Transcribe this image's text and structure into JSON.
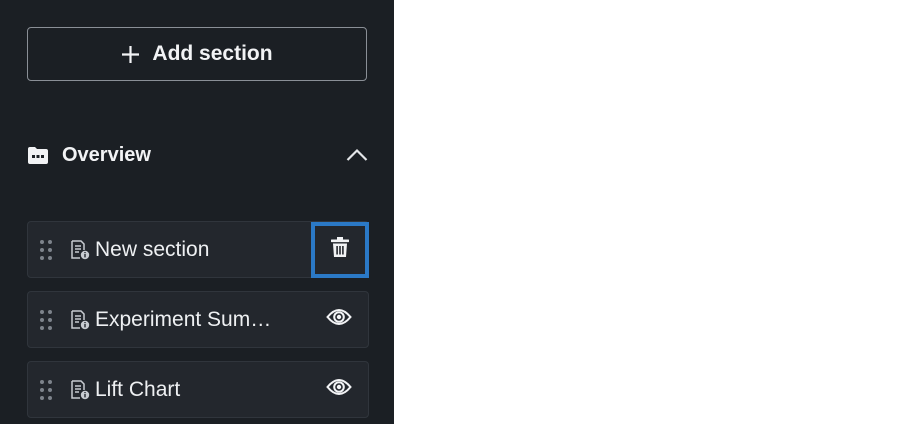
{
  "sidebar": {
    "add_section_label": "Add section",
    "group": {
      "title": "Overview",
      "expanded": true
    },
    "items": [
      {
        "label": "New section",
        "action_icon": "trash-icon",
        "action_selected": true
      },
      {
        "label": "Experiment Sum…",
        "action_icon": "eye-icon",
        "action_selected": false
      },
      {
        "label": "Lift Chart",
        "action_icon": "eye-icon",
        "action_selected": false
      }
    ]
  },
  "colors": {
    "sidebar_bg": "#1b1f24",
    "item_bg": "#23272d",
    "selection_border": "#2b79c6",
    "text": "#f2f3f5"
  }
}
